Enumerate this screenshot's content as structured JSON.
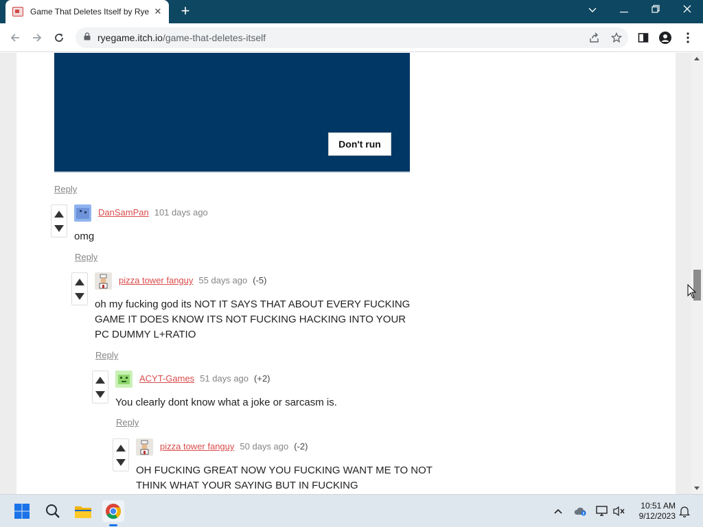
{
  "browser": {
    "tab_title": "Game That Deletes Itself by Rye",
    "tab_close": "✕",
    "new_tab": "+",
    "url_host": "ryegame.itch.io",
    "url_path": "/game-that-deletes-itself",
    "window_controls": {
      "dropdown": "⌵",
      "minimize": "—",
      "restore": "❐",
      "close": "✕"
    }
  },
  "embed": {
    "button_label": "Don't run",
    "background": "#003764"
  },
  "reply_label": "Reply",
  "comments": [
    {
      "user": "DanSamPan",
      "time": "101 days ago",
      "score": "",
      "body": "omg"
    },
    {
      "user": "pizza tower fanguy",
      "time": "55 days ago",
      "score": "(-5)",
      "body": "oh my fucking god its NOT IT SAYS THAT ABOUT EVERY FUCKING GAME IT DOES KNOW ITS NOT FUCKING HACKING INTO YOUR PC DUMMY L+RATIO"
    },
    {
      "user": "ACYT-Games",
      "time": "51 days ago",
      "score": "(+2)",
      "body": "You clearly dont know what a joke or sarcasm is."
    },
    {
      "user": "pizza tower fanguy",
      "time": "50 days ago",
      "score": "(-2)",
      "body": "OH FUCKING GREAT NOW YOU FUCKING WANT ME TO NOT THINK WHAT YOUR SAYING BUT IN FUCKING"
    }
  ],
  "taskbar": {
    "time": "10:51 AM",
    "date": "9/12/2023"
  },
  "colors": {
    "titlebar": "#0e4761",
    "username_link": "#da4a4a",
    "taskbar": "#dfe7ee"
  }
}
